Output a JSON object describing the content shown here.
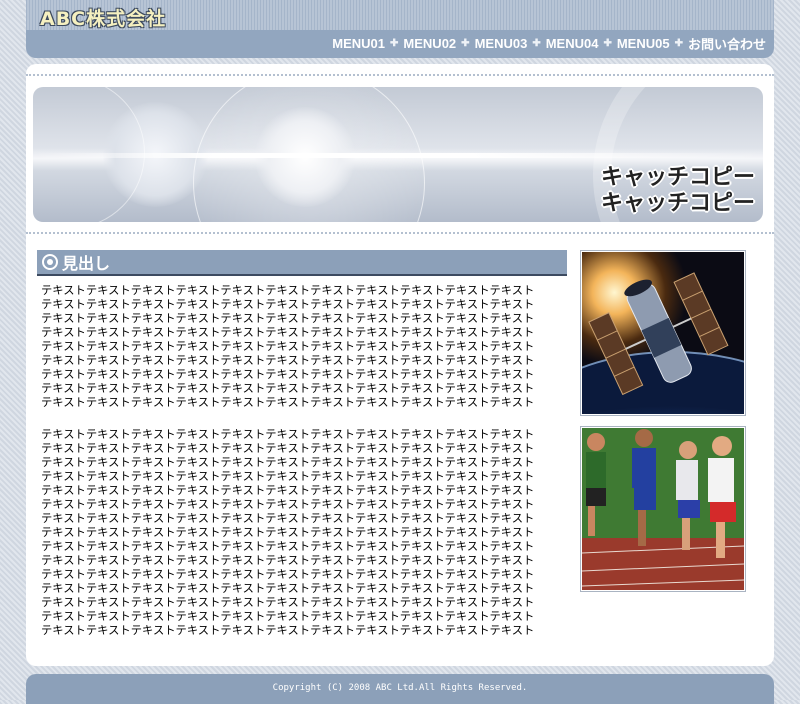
{
  "header": {
    "logo": "ABC株式会社",
    "nav": [
      {
        "label": "MENU01"
      },
      {
        "label": "MENU02"
      },
      {
        "label": "MENU03"
      },
      {
        "label": "MENU04"
      },
      {
        "label": "MENU05"
      },
      {
        "label": "お問い合わせ"
      }
    ],
    "separator_icon": "plus-icon"
  },
  "banner": {
    "catch_copy": [
      "キャッチコピー",
      "キャッチコピー"
    ]
  },
  "content": {
    "heading": "見出し",
    "heading_icon": "double-circle-icon",
    "paragraph1": [
      "テキストテキストテキストテキストテキストテキストテキストテキストテキストテキストテキスト",
      "テキストテキストテキストテキストテキストテキストテキストテキストテキストテキストテキスト",
      "テキストテキストテキストテキストテキストテキストテキストテキストテキストテキストテキスト",
      "テキストテキストテキストテキストテキストテキストテキストテキストテキストテキストテキスト",
      "テキストテキストテキストテキストテキストテキストテキストテキストテキストテキストテキスト",
      "テキストテキストテキストテキストテキストテキストテキストテキストテキストテキストテキスト",
      "テキストテキストテキストテキストテキストテキストテキストテキストテキストテキストテキスト",
      "テキストテキストテキストテキストテキストテキストテキストテキストテキストテキストテキスト",
      "テキストテキストテキストテキストテキストテキストテキストテキストテキストテキストテキスト"
    ],
    "paragraph2": [
      "テキストテキストテキストテキストテキストテキストテキストテキストテキストテキストテキスト",
      "テキストテキストテキストテキストテキストテキストテキストテキストテキストテキストテキスト",
      "テキストテキストテキストテキストテキストテキストテキストテキストテキストテキストテキスト",
      "テキストテキストテキストテキストテキストテキストテキストテキストテキストテキストテキスト",
      "テキストテキストテキストテキストテキストテキストテキストテキストテキストテキストテキスト",
      "テキストテキストテキストテキストテキストテキストテキストテキストテキストテキストテキスト",
      "テキストテキストテキストテキストテキストテキストテキストテキストテキストテキストテキスト",
      "テキストテキストテキストテキストテキストテキストテキストテキストテキストテキストテキスト",
      "テキストテキストテキストテキストテキストテキストテキストテキストテキストテキストテキスト",
      "テキストテキストテキストテキストテキストテキストテキストテキストテキストテキストテキスト",
      "テキストテキストテキストテキストテキストテキストテキストテキストテキストテキストテキスト",
      "テキストテキストテキストテキストテキストテキストテキストテキストテキストテキストテキスト",
      "テキストテキストテキストテキストテキストテキストテキストテキストテキストテキストテキスト",
      "テキストテキストテキストテキストテキストテキストテキストテキストテキストテキストテキスト",
      "テキストテキストテキストテキストテキストテキストテキストテキストテキストテキストテキスト"
    ],
    "photos": [
      "satellite-photo",
      "runners-photo"
    ]
  },
  "footer": {
    "copyright": "Copyright (C) 2008 ABC Ltd.All Rights Reserved."
  },
  "colors": {
    "header": "#92a6bf",
    "heading_bar": "#8ca0b9",
    "background": "#d5dbe4"
  }
}
